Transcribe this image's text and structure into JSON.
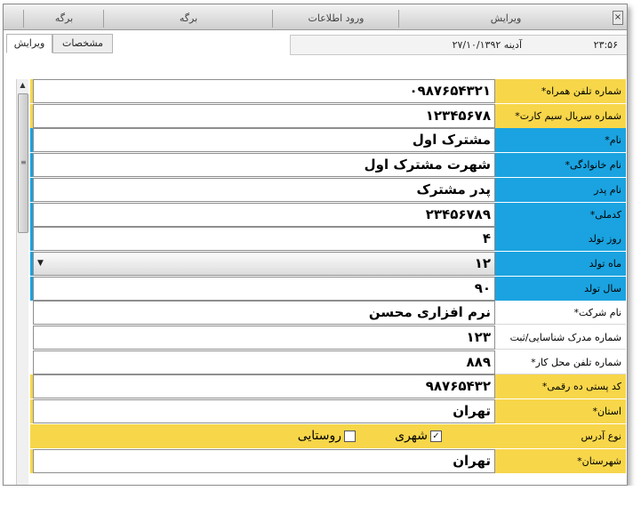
{
  "top_tabs": [
    {
      "label": "ویرایش"
    },
    {
      "label": "ورود اطلاعات"
    },
    {
      "label": "برگه"
    },
    {
      "label": "برگه"
    }
  ],
  "view_tabs": [
    {
      "label": "ویرایش",
      "active": true
    },
    {
      "label": "مشخصات",
      "active": false
    }
  ],
  "status": {
    "date": "آدینه ۲۷/۱۰/۱۳۹۲",
    "time": "۲۳:۵۶"
  },
  "form": {
    "rows": [
      {
        "label": "شماره تلفن همراه*",
        "value": "۰۹۸۷۶۵۴۳۲۱",
        "color": "#f7d64a"
      },
      {
        "label": "شماره سریال سیم کارت*",
        "value": "۱۲۳۴۵۶۷۸",
        "color": "#f7d64a"
      },
      {
        "label": "نام*",
        "value": "مشترک اول",
        "color": "#1aa3e0"
      },
      {
        "label": "نام خانوادگی*",
        "value": "شهرت مشترک اول",
        "color": "#1aa3e0"
      },
      {
        "label": "نام پدر",
        "value": "پدر مشترک",
        "color": "#1aa3e0"
      },
      {
        "label": "کدملی*",
        "value": "۲۳۴۵۶۷۸۹",
        "color": "#1aa3e0"
      },
      {
        "label": "روز تولد",
        "value": "۴",
        "color": "#1aa3e0"
      },
      {
        "label": "ماه تولد",
        "value": "۱۲",
        "color": "#1aa3e0",
        "combo": true
      },
      {
        "label": "سال تولد",
        "value": "۹۰",
        "color": "#1aa3e0"
      },
      {
        "label": "نام شرکت*",
        "value": "نرم افزاری محسن",
        "color": "#ffffff"
      },
      {
        "label": "شماره مدرک شناسایی/ثبت",
        "value": "۱۲۳",
        "color": "#ffffff"
      },
      {
        "label": "شماره تلفن محل کار*",
        "value": "۸۸۹",
        "color": "#ffffff"
      },
      {
        "label": "کد پستی ده رقمی*",
        "value": "۹۸۷۶۵۴۳۲",
        "color": "#f7d64a"
      },
      {
        "label": "استان*",
        "value": "تهران",
        "color": "#f7d64a"
      }
    ],
    "address_type": {
      "label": "نوع آدرس",
      "color": "#f7d64a",
      "options": [
        {
          "label": "شهری",
          "checked": true
        },
        {
          "label": "روستایی",
          "checked": false
        }
      ]
    },
    "county": {
      "label": "شهرستان*",
      "value": "تهران",
      "color": "#f7d64a"
    }
  }
}
